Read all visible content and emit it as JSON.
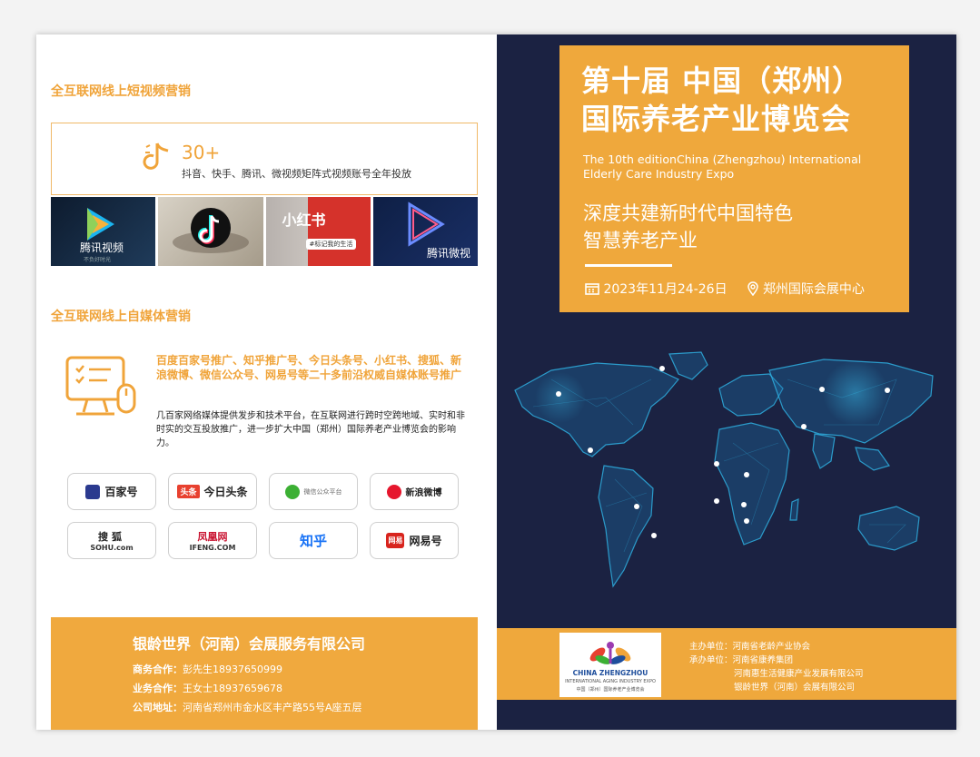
{
  "left": {
    "short_video": {
      "heading": "全互联网线上短视频营销",
      "count": "30+",
      "description": "抖音、快手、腾讯、微视频矩阵式视频账号全年投放",
      "thumbnails": [
        "腾讯视频",
        "",
        "小红书",
        "腾讯微视"
      ],
      "thumb_sub": "不负好时光",
      "xhs_tag": "#标记我的生活"
    },
    "self_media": {
      "heading": "全互联网线上自媒体营销",
      "title": "百度百家号推广、知乎推广号、今日头条号、小红书、搜狐、新浪微博、微信公众号、网易号等二十多前沿权威自媒体账号推广",
      "body": "几百家网络媒体提供发步和技术平台，在互联网进行跨时空跨地域、实时和非时实的交互投放推广，进一步扩大中国（郑州）国际养老产业博览会的影响力。"
    },
    "platforms": [
      {
        "name": "百家号",
        "icon": "baijiahao-icon",
        "color": "#2b3a8f"
      },
      {
        "name": "今日头条",
        "badge": "头条",
        "icon": "toutiao-icon",
        "color": "#e8402f"
      },
      {
        "name": "微信公众平台",
        "icon": "wechat-icon",
        "color": "#3cb034"
      },
      {
        "name": "新浪微博",
        "icon": "weibo-icon",
        "color": "#e6162d"
      },
      {
        "name": "搜狐",
        "sub": "SOHU.com",
        "icon": "sohu-icon",
        "color": "#333333"
      },
      {
        "name": "凤凰网",
        "sub": "IFENG.COM",
        "icon": "ifeng-icon",
        "color": "#c8102e"
      },
      {
        "name": "知乎",
        "icon": "zhihu-icon",
        "color": "#1772f6"
      },
      {
        "name": "网易号",
        "badge": "网易",
        "icon": "netease-icon",
        "color": "#d8241d"
      }
    ],
    "contact": {
      "company": "银龄世界（河南）会展服务有限公司",
      "biz_label": "商务合作：",
      "biz_value": "彭先生18937650999",
      "ops_label": "业务合作：",
      "ops_value": "王女士18937659678",
      "addr_label": "公司地址：",
      "addr_value": "河南省郑州市金水区丰产路55号A座五层"
    }
  },
  "right": {
    "title_line1": "第十届  中国（郑州）",
    "title_line2": "国际养老产业博览会",
    "title_en": "The 10th editionChina (Zhengzhou) International Elderly Care Industry Expo",
    "theme_line1": "深度共建新时代中国特色",
    "theme_line2": "智慧养老产业",
    "date": "2023年11月24-26日",
    "venue": "郑州国际会展中心",
    "logo_name": "CHINA ZHENGZHOU",
    "logo_sub": "INTERNATIONAL AGING INDUSTRY EXPO",
    "logo_cn": "中国（郑州）国际养老产业博览会",
    "organizers": {
      "host_label": "主办单位：",
      "host": "河南省老龄产业协会",
      "co_label": "承办单位：",
      "co1": "河南省康养集团",
      "co2": "河南惠生活健康产业发展有限公司",
      "co3": "银龄世界（河南）会展有限公司"
    }
  },
  "colors": {
    "accent": "#f0a93e",
    "navy": "#1b2242",
    "map_cyan": "#2fb6e8"
  }
}
